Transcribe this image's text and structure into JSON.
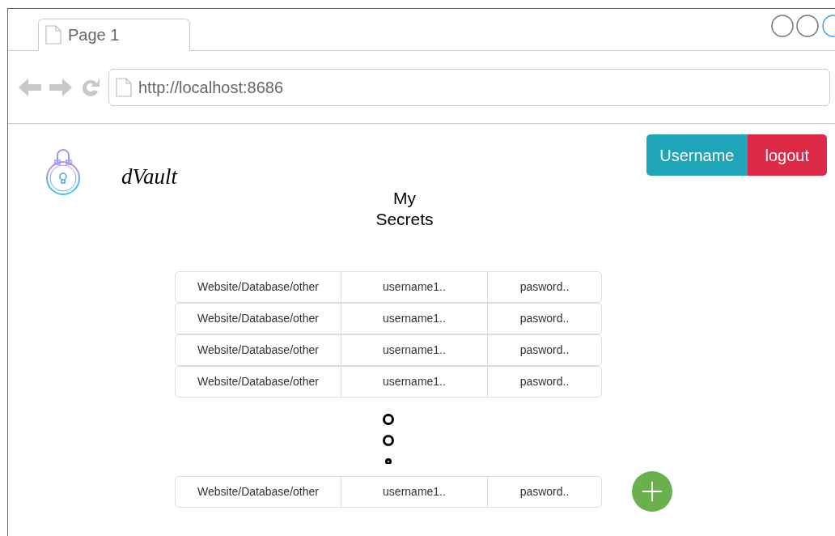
{
  "browser": {
    "tab": {
      "title": "Page 1"
    },
    "url": "http://localhost:8686"
  },
  "header": {
    "app_name": "dVault",
    "user_button": "Username",
    "logout_button": "logout"
  },
  "title": "My Secrets",
  "secrets": [
    {
      "site": "Website/Database/other",
      "username": "username1..",
      "password": "pasword.."
    },
    {
      "site": "Website/Database/other",
      "username": "username1..",
      "password": "pasword.."
    },
    {
      "site": "Website/Database/other",
      "username": "username1..",
      "password": "pasword.."
    },
    {
      "site": "Website/Database/other",
      "username": "username1..",
      "password": "pasword.."
    }
  ],
  "last_secret": {
    "site": "Website/Database/other",
    "username": "username1..",
    "password": "pasword.."
  }
}
